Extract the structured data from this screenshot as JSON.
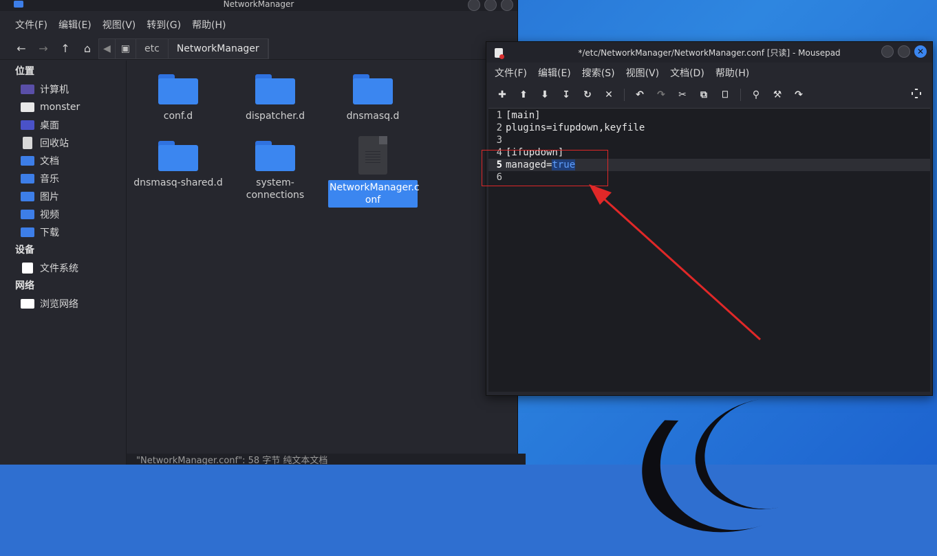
{
  "file_manager": {
    "title": "NetworkManager",
    "menu": [
      "文件(F)",
      "编辑(E)",
      "视图(V)",
      "转到(G)",
      "帮助(H)"
    ],
    "path": [
      "etc",
      "NetworkManager"
    ],
    "sidebar": {
      "places_header": "位置",
      "places": [
        {
          "label": "计算机",
          "icon": "computer-icon"
        },
        {
          "label": "monster",
          "icon": "home-folder-icon"
        },
        {
          "label": "桌面",
          "icon": "desktop-folder-icon"
        },
        {
          "label": "回收站",
          "icon": "trash-icon"
        },
        {
          "label": "文档",
          "icon": "documents-folder-icon"
        },
        {
          "label": "音乐",
          "icon": "music-folder-icon"
        },
        {
          "label": "图片",
          "icon": "pictures-folder-icon"
        },
        {
          "label": "视频",
          "icon": "videos-folder-icon"
        },
        {
          "label": "下载",
          "icon": "downloads-folder-icon"
        }
      ],
      "devices_header": "设备",
      "devices": [
        {
          "label": "文件系统",
          "icon": "filesystem-icon"
        }
      ],
      "network_header": "网络",
      "network": [
        {
          "label": "浏览网络",
          "icon": "network-icon"
        }
      ]
    },
    "items": [
      {
        "name": "conf.d",
        "type": "folder"
      },
      {
        "name": "dispatcher.d",
        "type": "folder"
      },
      {
        "name": "dnsmasq.d",
        "type": "folder"
      },
      {
        "name": "dnsmasq-shared.d",
        "type": "folder"
      },
      {
        "name": "system-\nconnections",
        "type": "folder"
      },
      {
        "name": "NetworkManager.c\nonf",
        "type": "file",
        "selected": true
      }
    ],
    "status": "\"NetworkManager.conf\": 58 字节 纯文本文档"
  },
  "mousepad": {
    "title": "*/etc/NetworkManager/NetworkManager.conf [只读] - Mousepad",
    "menu": [
      "文件(F)",
      "编辑(E)",
      "搜索(S)",
      "视图(V)",
      "文档(D)",
      "帮助(H)"
    ],
    "lines": [
      {
        "num": "1",
        "text": "[main]"
      },
      {
        "num": "2",
        "text": "plugins=ifupdown,keyfile"
      },
      {
        "num": "3",
        "text": ""
      },
      {
        "num": "4",
        "text": "[ifupdown]"
      },
      {
        "num": "5",
        "key": "managed=",
        "value": "true",
        "current": true
      },
      {
        "num": "6",
        "text": ""
      }
    ]
  },
  "colors": {
    "accent": "#3b86f0",
    "annotation": "#e02828"
  }
}
